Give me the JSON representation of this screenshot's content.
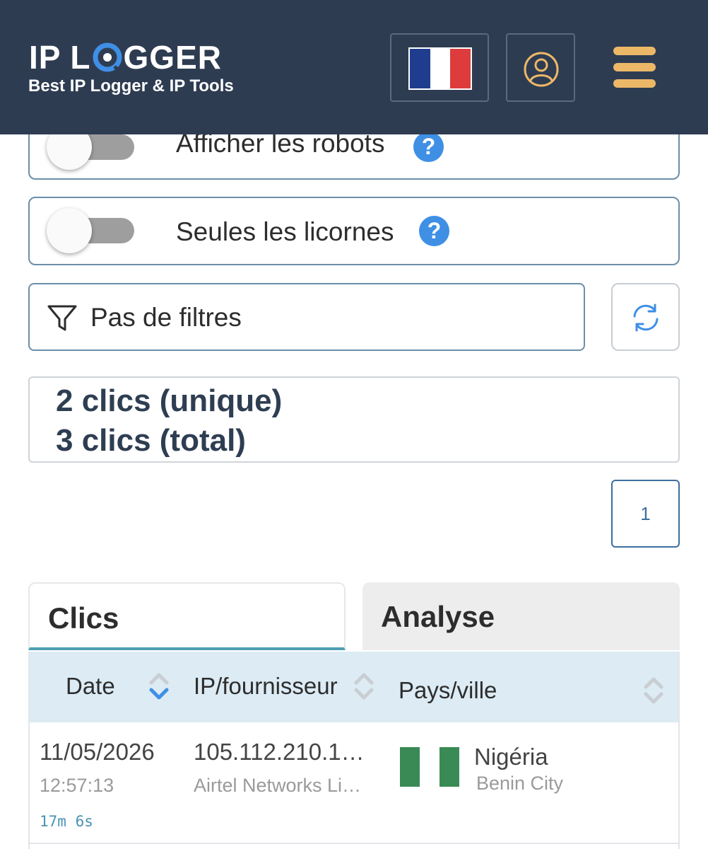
{
  "header": {
    "logo_part1": "IP L",
    "logo_part2": "GGER",
    "tagline": "Best IP Logger & IP Tools",
    "lang_flag": "france-flag",
    "user_icon": "user-circle-icon",
    "menu_icon": "hamburger-menu-icon",
    "colors": {
      "background": "#2e3c52",
      "accent": "#ecb868"
    }
  },
  "options": {
    "robots_label": "Afficher les robots",
    "unicorns_label": "Seules les licornes",
    "help_glyph": "?"
  },
  "filter": {
    "label": "Pas de filtres",
    "icon": "filter-funnel-icon",
    "refresh_icon": "refresh-icon"
  },
  "stats": {
    "unique": "2 clics (unique)",
    "total": "3 clics (total)"
  },
  "pagination": {
    "current": "1"
  },
  "tabs": [
    {
      "label": "Clics",
      "active": true
    },
    {
      "label": "Analyse",
      "active": false
    }
  ],
  "table": {
    "columns": [
      "Date",
      "IP/fournisseur",
      "Pays/ville"
    ],
    "rows": [
      {
        "date": "11/05/2026",
        "time": "12:57:13",
        "duration": "17m 6s",
        "ip": "105.112.210.1…",
        "provider": "Airtel Networks Li…",
        "country": "Nigéria",
        "city": "Benin City",
        "flag": "nigeria-flag"
      }
    ]
  }
}
